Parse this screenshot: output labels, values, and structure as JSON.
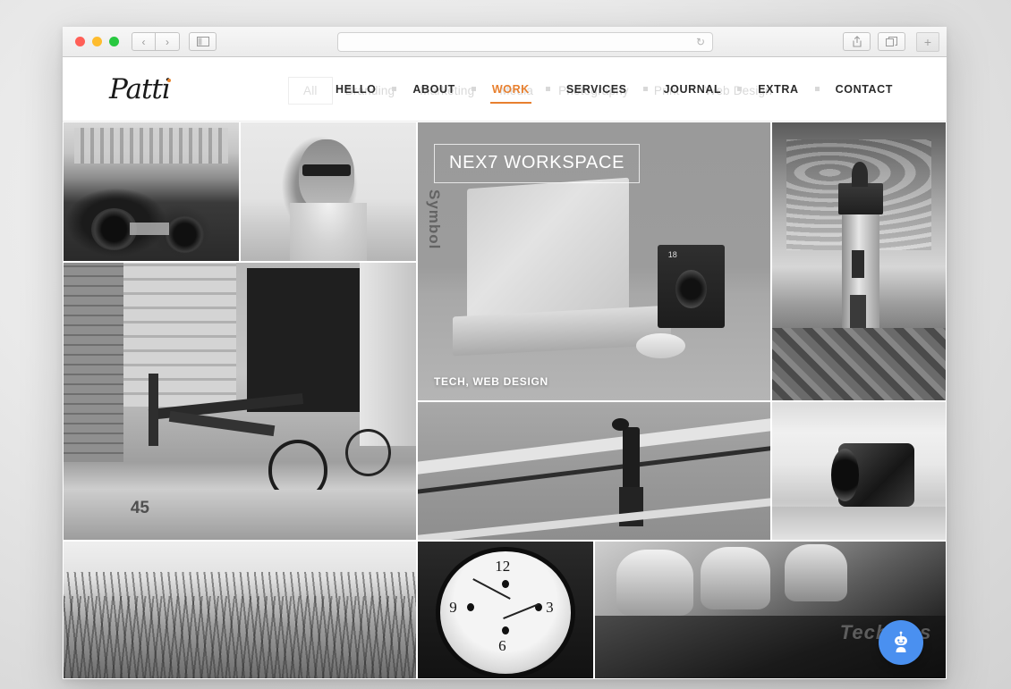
{
  "browser": {
    "window_controls": [
      "close",
      "minimize",
      "maximize"
    ],
    "back_label": "‹",
    "forward_label": "›",
    "sidebar_icon": "sidebar-icon",
    "url_value": "",
    "url_placeholder": "",
    "reload_label": "↻",
    "share_icon": "share-icon",
    "tabs_icon": "tabs-icon",
    "new_tab_label": "+"
  },
  "site": {
    "logo_text": "Patti",
    "filters": [
      {
        "label": "All",
        "active": true
      },
      {
        "label": "Branding",
        "active": false
      },
      {
        "label": "Marketing",
        "active": false
      },
      {
        "label": "Media",
        "active": false
      },
      {
        "label": "Photography",
        "active": false
      },
      {
        "label": "Print",
        "active": false
      },
      {
        "label": "Web Design",
        "active": false
      }
    ],
    "nav": [
      {
        "label": "HELLO",
        "active": false
      },
      {
        "label": "ABOUT",
        "active": false
      },
      {
        "label": "WORK",
        "active": true
      },
      {
        "label": "SERVICES",
        "active": false
      },
      {
        "label": "JOURNAL",
        "active": false
      },
      {
        "label": "EXTRA",
        "active": false
      },
      {
        "label": "CONTACT",
        "active": false
      }
    ],
    "accent_color": "#e8802f"
  },
  "gallery": {
    "featured": {
      "title": "NEX7 WORKSPACE",
      "caption": "TECH, WEB DESIGN"
    },
    "tiles": [
      {
        "name": "tile-vintage-car",
        "alt": "Vintage black and white car parked on street"
      },
      {
        "name": "tile-portrait",
        "alt": "Woman in sunglasses portrait in field"
      },
      {
        "name": "tile-workspace",
        "alt": "Laptop, mouse and speaker workspace"
      },
      {
        "name": "tile-lighthouse",
        "alt": "Lighthouse on rocky shore under clouds"
      },
      {
        "name": "tile-bicycle",
        "alt": "Folding bicycle chained near doorway, number 45"
      },
      {
        "name": "tile-crosswalk",
        "alt": "Man walking across road markings"
      },
      {
        "name": "tile-lens",
        "alt": "Camera lens close up"
      },
      {
        "name": "tile-field",
        "alt": "Tall grass reeds in a field"
      },
      {
        "name": "tile-clock",
        "alt": "Vintage wall clock face showing numbers 12, 3, 6, 9"
      },
      {
        "name": "tile-guitar",
        "alt": "Guitar headstock with tuning pegs"
      }
    ]
  },
  "chat": {
    "label": "chat-bot-button",
    "color": "#4a90f0"
  }
}
